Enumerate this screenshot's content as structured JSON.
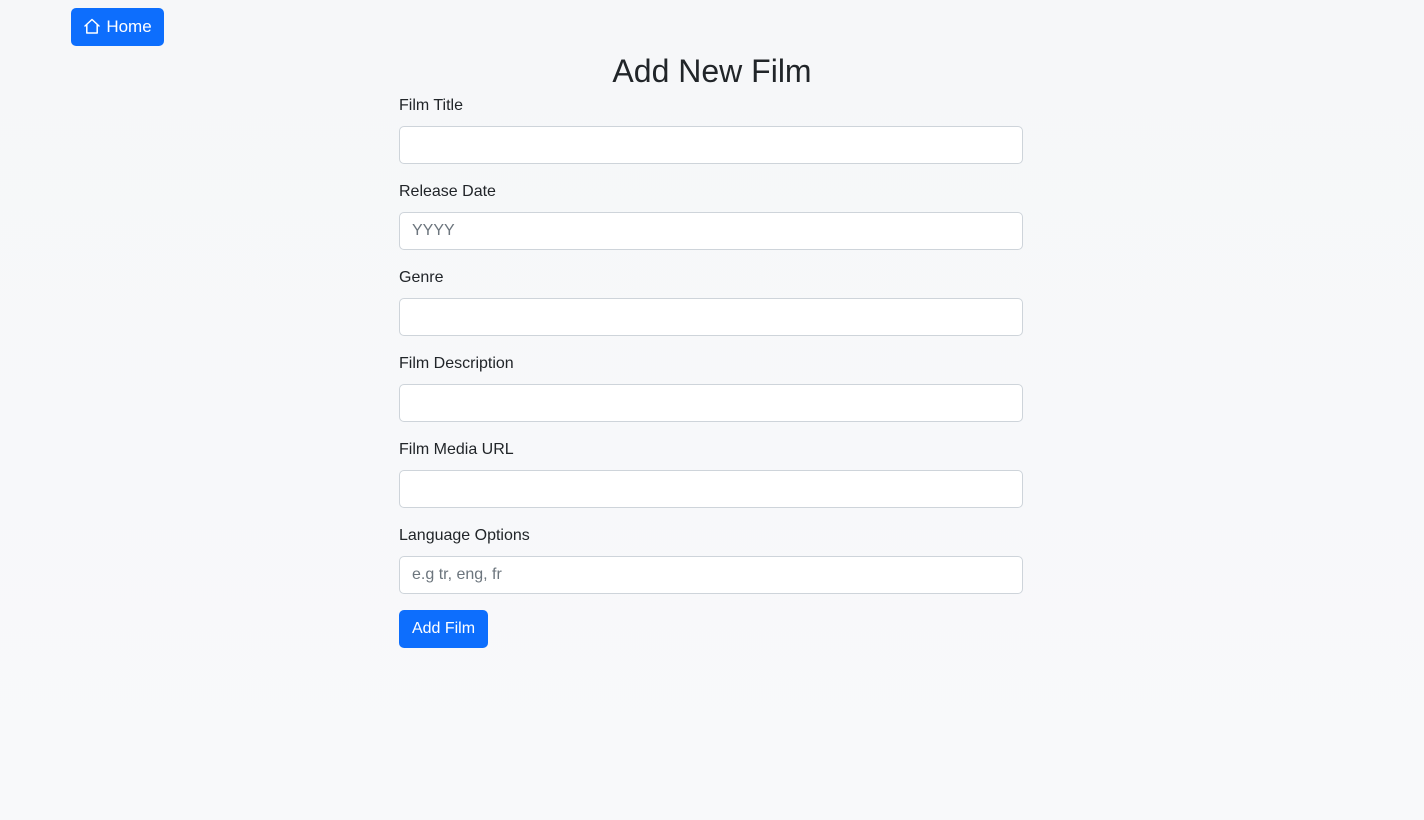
{
  "nav": {
    "home_label": "Home",
    "home_icon": "house-icon"
  },
  "page": {
    "title": "Add New Film"
  },
  "form": {
    "fields": [
      {
        "label": "Film Title",
        "value": "",
        "placeholder": ""
      },
      {
        "label": "Release Date",
        "value": "",
        "placeholder": "YYYY"
      },
      {
        "label": "Genre",
        "value": "",
        "placeholder": ""
      },
      {
        "label": "Film Description",
        "value": "",
        "placeholder": ""
      },
      {
        "label": "Film Media URL",
        "value": "",
        "placeholder": ""
      },
      {
        "label": "Language Options",
        "value": "",
        "placeholder": "e.g tr, eng, fr"
      }
    ],
    "submit_label": "Add Film"
  },
  "colors": {
    "primary": "#0d6efd",
    "border": "#ced4da",
    "text": "#212529",
    "placeholder": "#6c757d",
    "background": "#f8f9fa"
  }
}
